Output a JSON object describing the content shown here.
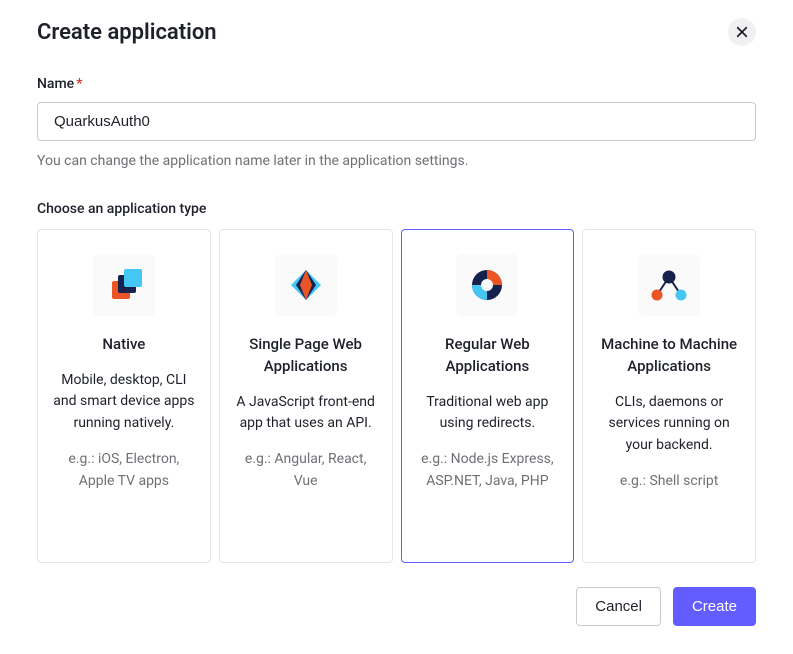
{
  "header": {
    "title": "Create application"
  },
  "form": {
    "name_label": "Name",
    "name_value": "QuarkusAuth0",
    "name_helper": "You can change the application name later in the application settings.",
    "type_label": "Choose an application type"
  },
  "types": [
    {
      "title": "Native",
      "description": "Mobile, desktop, CLI and smart device apps running natively.",
      "examples": "e.g.: iOS, Electron, Apple TV apps"
    },
    {
      "title": "Single Page Web Applications",
      "description": "A JavaScript front-end app that uses an API.",
      "examples": "e.g.: Angular, React, Vue"
    },
    {
      "title": "Regular Web Applications",
      "description": "Traditional web app using redirects.",
      "examples": "e.g.: Node.js Express, ASP.NET, Java, PHP"
    },
    {
      "title": "Machine to Machine Applications",
      "description": "CLIs, daemons or services running on your backend.",
      "examples": "e.g.: Shell script"
    }
  ],
  "buttons": {
    "cancel": "Cancel",
    "create": "Create"
  },
  "selected_index": 2
}
